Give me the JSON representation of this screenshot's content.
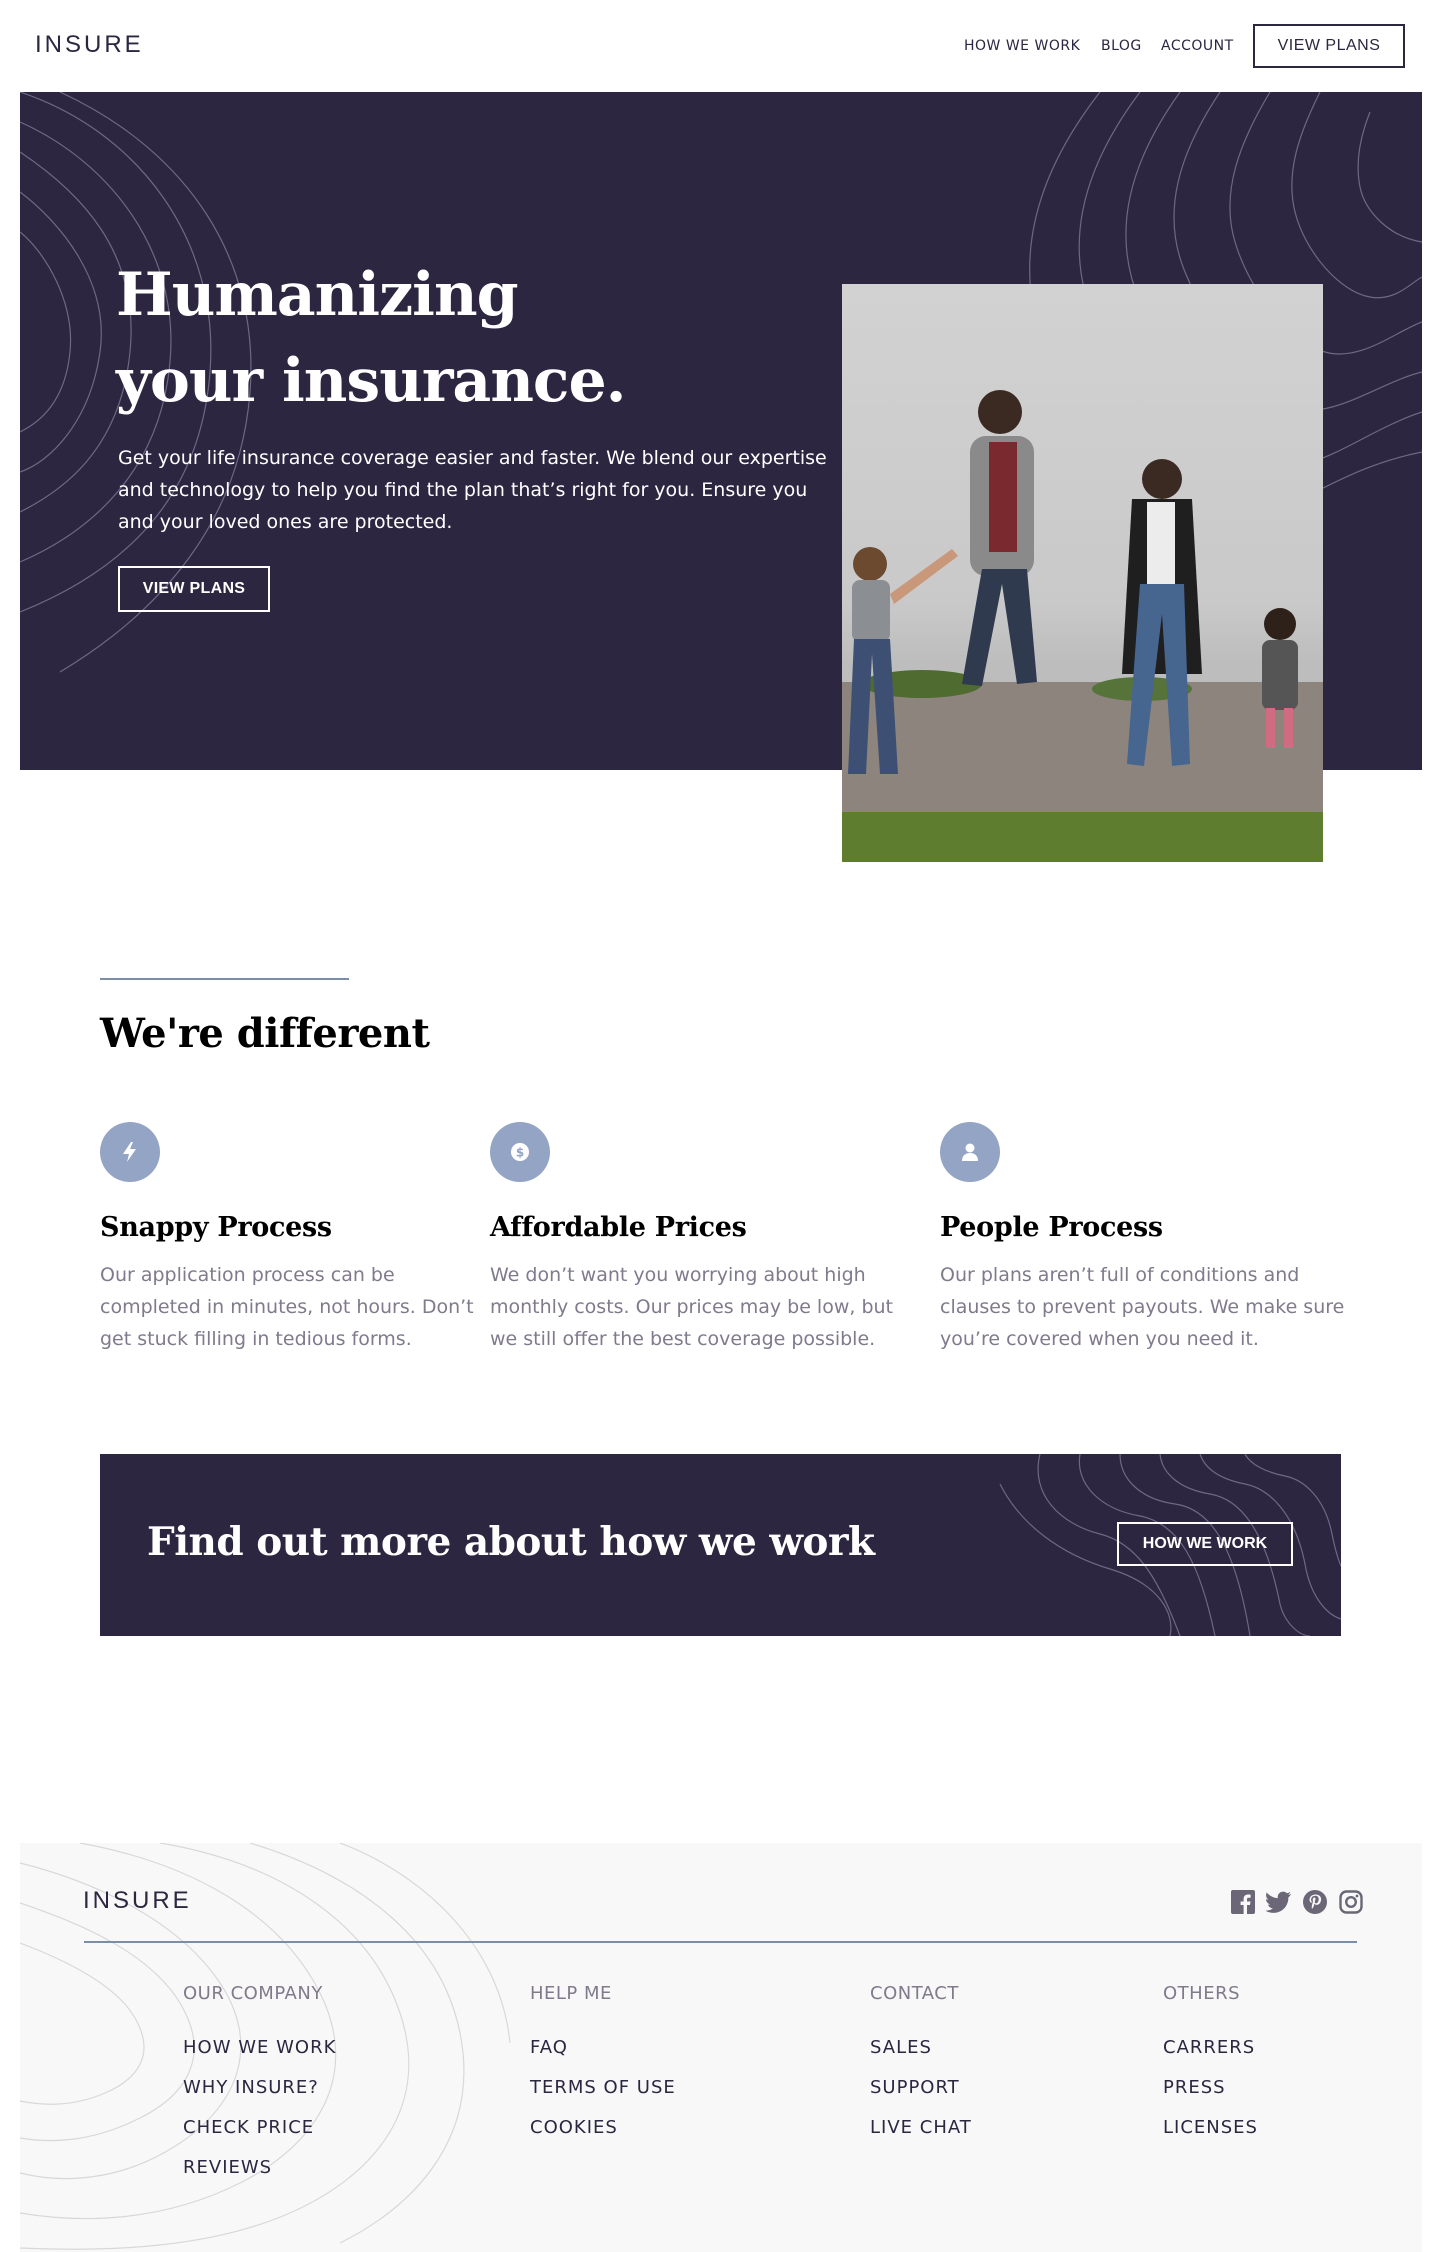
{
  "nav": {
    "logo": "INSURE",
    "links": [
      "HOW WE WORK",
      "BLOG",
      "ACCOUNT"
    ],
    "cta": "VIEW PLANS"
  },
  "hero": {
    "title": "Humanizing your insurance.",
    "text": "Get your life insurance coverage easier and faster. We blend our expertise and technology to help you find the plan that’s right for you. Ensure you and your loved ones are protected.",
    "button": "VIEW PLANS"
  },
  "different": {
    "title": "We're different",
    "features": [
      {
        "icon": "lightning-icon",
        "title": "Snappy Process",
        "text": "Our application process can be completed in minutes, not hours. Don’t get stuck filling in tedious forms."
      },
      {
        "icon": "dollar-icon",
        "title": "Affordable Prices",
        "text": "We don’t want you worrying about high monthly costs. Our prices may be low, but we still offer the best coverage possible."
      },
      {
        "icon": "person-icon",
        "title": "People Process",
        "text": "Our plans aren’t full of conditions and clauses to prevent payouts. We make sure you’re covered when you need it."
      }
    ]
  },
  "cta": {
    "title": "Find out more about how we work",
    "button": "HOW WE WORK"
  },
  "footer": {
    "logo": "INSURE",
    "socials": [
      "facebook-icon",
      "twitter-icon",
      "pinterest-icon",
      "instagram-icon"
    ],
    "columns": [
      {
        "heading": "OUR COMPANY",
        "items": [
          "HOW WE WORK",
          "WHY INSURE?",
          "CHECK PRICE",
          "REVIEWS"
        ]
      },
      {
        "heading": "HELP ME",
        "items": [
          "FAQ",
          "TERMS OF USE",
          "COOKIES"
        ]
      },
      {
        "heading": "CONTACT",
        "items": [
          "SALES",
          "SUPPORT",
          "LIVE CHAT"
        ]
      },
      {
        "heading": "OTHERS",
        "items": [
          "CARRERS",
          "PRESS",
          "LICENSES"
        ]
      }
    ]
  },
  "colors": {
    "dark_violet": "#2c2640",
    "grayish_blue": "#93a4c4",
    "line_blue": "#7b8ea8",
    "footer_bg": "#f8f8f8"
  }
}
